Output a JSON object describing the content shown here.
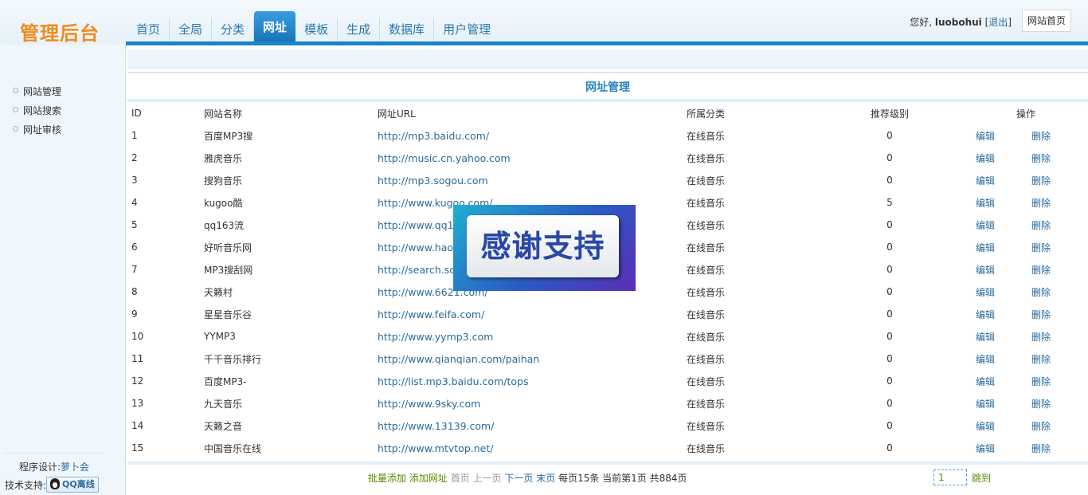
{
  "header": {
    "logo": "管理后台",
    "nav": [
      {
        "label": "首页",
        "active": false
      },
      {
        "label": "全局",
        "active": false
      },
      {
        "label": "分类",
        "active": false
      },
      {
        "label": "网址",
        "active": true
      },
      {
        "label": "模板",
        "active": false
      },
      {
        "label": "生成",
        "active": false
      },
      {
        "label": "数据库",
        "active": false
      },
      {
        "label": "用户管理",
        "active": false
      }
    ],
    "greeting": "您好,",
    "username": "luobohui",
    "logout_open": "[",
    "logout_label": "退出",
    "logout_close": "]",
    "site_home_label": "网站首页"
  },
  "sidebar": {
    "items": [
      {
        "label": "网站管理"
      },
      {
        "label": "网站搜索"
      },
      {
        "label": "网址审核"
      }
    ],
    "credit_label": "程序设计:",
    "credit_author": "萝卜会",
    "support_label": "技术支持:",
    "qq_status": "QQ离线"
  },
  "main": {
    "title": "网址管理",
    "columns": {
      "id": "ID",
      "name": "网站名称",
      "url": "网址URL",
      "category": "所属分类",
      "level": "推荐级别",
      "ops": "操作"
    },
    "edit_label": "编辑",
    "delete_label": "删除",
    "rows": [
      {
        "id": "1",
        "name": "百度MP3搜",
        "url": "http://mp3.baidu.com/",
        "category": "在线音乐",
        "level": "0"
      },
      {
        "id": "2",
        "name": "雅虎音乐",
        "url": "http://music.cn.yahoo.com",
        "category": "在线音乐",
        "level": "0"
      },
      {
        "id": "3",
        "name": "搜狗音乐",
        "url": "http://mp3.sogou.com",
        "category": "在线音乐",
        "level": "0"
      },
      {
        "id": "4",
        "name": "kugoo酷",
        "url": "http://www.kugoo.com/",
        "category": "在线音乐",
        "level": "5"
      },
      {
        "id": "5",
        "name": "qq163流",
        "url": "http://www.qq163.com/",
        "category": "在线音乐",
        "level": "0"
      },
      {
        "id": "6",
        "name": "好听音乐网",
        "url": "http://www.haoting.com/",
        "category": "在线音乐",
        "level": "0"
      },
      {
        "id": "7",
        "name": "MP3搜刮网",
        "url": "http://search.sogua.com/",
        "category": "在线音乐",
        "level": "0"
      },
      {
        "id": "8",
        "name": "天籁村",
        "url": "http://www.6621.com/",
        "category": "在线音乐",
        "level": "0"
      },
      {
        "id": "9",
        "name": "星星音乐谷",
        "url": "http://www.feifa.com/",
        "category": "在线音乐",
        "level": "0"
      },
      {
        "id": "10",
        "name": "YYMP3",
        "url": "http://www.yymp3.com",
        "category": "在线音乐",
        "level": "0"
      },
      {
        "id": "11",
        "name": "千千音乐排行",
        "url": "http://www.qianqian.com/paihan",
        "category": "在线音乐",
        "level": "0"
      },
      {
        "id": "12",
        "name": "百度MP3-",
        "url": "http://list.mp3.baidu.com/tops",
        "category": "在线音乐",
        "level": "0"
      },
      {
        "id": "13",
        "name": "九天音乐",
        "url": "http://www.9sky.com",
        "category": "在线音乐",
        "level": "0"
      },
      {
        "id": "14",
        "name": "天籁之音",
        "url": "http://www.13139.com/",
        "category": "在线音乐",
        "level": "0"
      },
      {
        "id": "15",
        "name": "中国音乐在线",
        "url": "http://www.mtvtop.net/",
        "category": "在线音乐",
        "level": "0"
      }
    ]
  },
  "pager": {
    "batch_add": "批量添加",
    "add_url": "添加网址",
    "first": "首页",
    "prev": "上一页",
    "next": "下一页",
    "last": "末页",
    "per_page": "每页15条",
    "current": "当前第1页",
    "total": "共884页",
    "jump_value": "1",
    "jump_label": "跳到"
  },
  "overlay": {
    "text": "感谢支持"
  }
}
